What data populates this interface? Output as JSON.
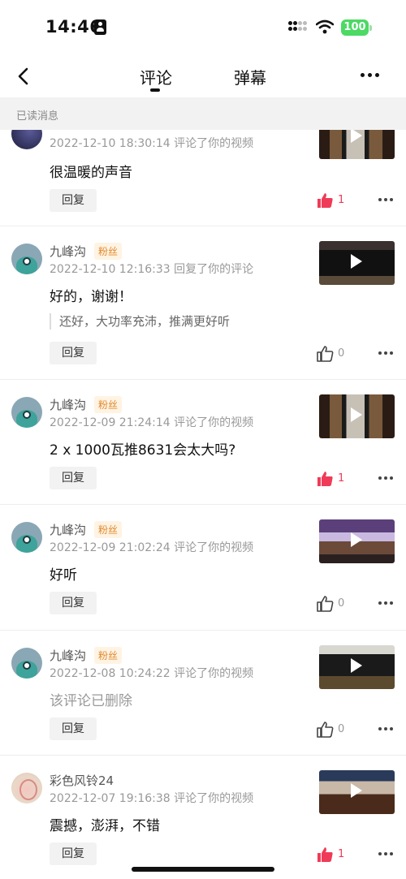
{
  "status_bar": {
    "time": "14:46",
    "battery": "100",
    "battery_color": "#4cd964"
  },
  "nav": {
    "tabs": [
      {
        "label": "评论",
        "active": true
      },
      {
        "label": "弹幕",
        "active": false
      }
    ]
  },
  "section_header": "已读消息",
  "reply_label": "回复",
  "like_active_color": "#ef3b57",
  "badge_label": "粉丝",
  "items": [
    {
      "name": "",
      "meta": "2022-12-10 18:30:14 评论了你的视频",
      "content": "很温暖的声音",
      "likes": "1",
      "liked": true,
      "avatar": "dark",
      "thumb": "speakers"
    },
    {
      "name": "九峰沟",
      "badge": true,
      "meta": "2022-12-10 12:16:33 回复了你的评论",
      "content": "好的，谢谢！",
      "quote": "还好，大功率充沛，推满更好听",
      "likes": "0",
      "liked": false,
      "avatar": "fish",
      "thumb": "amp"
    },
    {
      "name": "九峰沟",
      "badge": true,
      "meta": "2022-12-09 21:24:14 评论了你的视频",
      "content": "2 x 1000瓦推8631会太大吗?",
      "likes": "1",
      "liked": true,
      "avatar": "fish",
      "thumb": "speakers"
    },
    {
      "name": "九峰沟",
      "badge": true,
      "meta": "2022-12-09 21:02:24 评论了你的视频",
      "content": "好听",
      "likes": "0",
      "liked": false,
      "avatar": "fish",
      "thumb": "stage"
    },
    {
      "name": "九峰沟",
      "badge": true,
      "meta": "2022-12-08 10:24:22 评论了你的视频",
      "content": "该评论已删除",
      "deleted": true,
      "likes": "0",
      "liked": false,
      "avatar": "fish",
      "thumb": "box"
    },
    {
      "name": "彩色风铃24",
      "badge": false,
      "meta": "2022-12-07 19:16:38 评论了你的视频",
      "content": "震撼，澎湃，不错",
      "likes": "1",
      "liked": true,
      "avatar": "flower",
      "thumb": "blue"
    }
  ]
}
